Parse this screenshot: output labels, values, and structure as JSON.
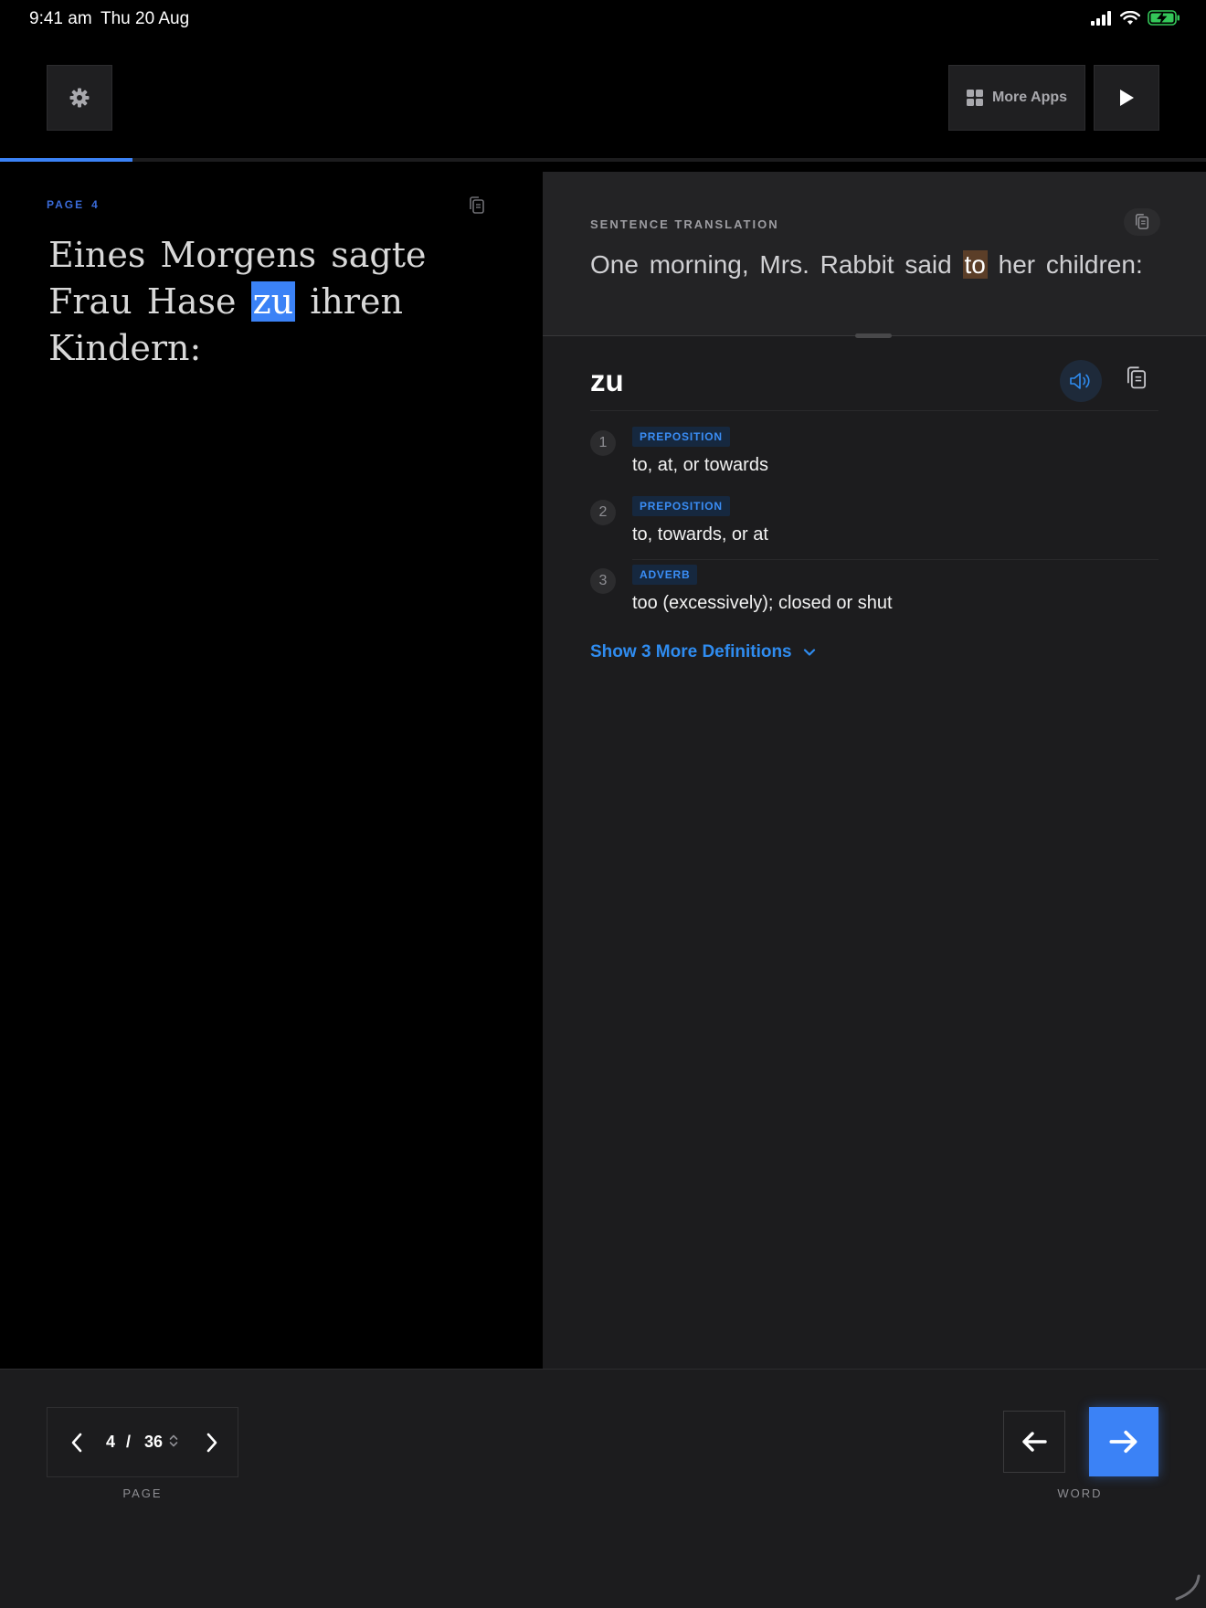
{
  "status_bar": {
    "time": "9:41 am",
    "date": "Thu 20 Aug",
    "battery_color": "#34c759"
  },
  "toolbar": {
    "more_apps_label": "More Apps"
  },
  "progress": {
    "fraction": 0.11,
    "color": "#3b82f6"
  },
  "source": {
    "page_label": "PAGE",
    "page_number": "4",
    "text_before": "Eines Morgens sagte Frau Hase",
    "highlighted_word": "zu",
    "text_after": "ihren Kindern:"
  },
  "translation": {
    "label": "SENTENCE TRANSLATION",
    "text_before": "One morning, Mrs. Rabbit said",
    "highlighted_word": "to",
    "text_after": "her children:"
  },
  "dictionary": {
    "headword": "zu",
    "definitions": [
      {
        "number": "1",
        "pos": "PREPOSITION",
        "text": "to, at, or towards"
      },
      {
        "number": "2",
        "pos": "PREPOSITION",
        "text": "to, towards, or at"
      },
      {
        "number": "3",
        "pos": "ADVERB",
        "text": "too (excessively); closed or shut"
      }
    ],
    "show_more_label": "Show 3 More Definitions"
  },
  "pager": {
    "current": "4",
    "separator": "/",
    "total": "36",
    "caption": "PAGE"
  },
  "word_nav": {
    "caption": "WORD"
  },
  "colors": {
    "accent": "#3b82f6",
    "link": "#2f8cf0",
    "pos_badge_bg": "#16283f"
  }
}
